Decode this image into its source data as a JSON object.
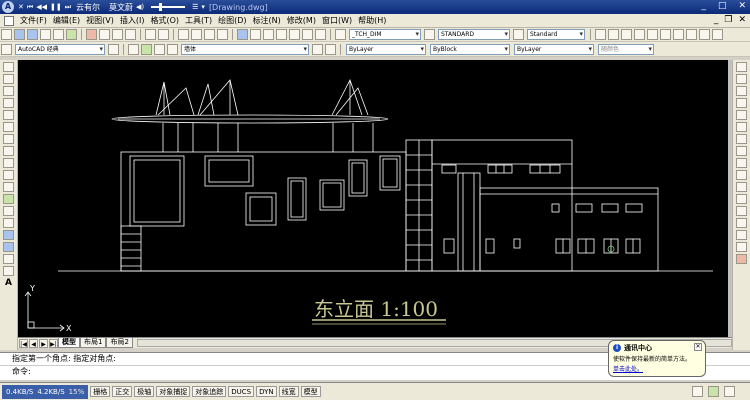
{
  "media": {
    "track": "云有尔",
    "artist": "莫文蔚",
    "doc_title": "[Drawing.dwg]"
  },
  "menu": [
    "文件(F)",
    "编辑(E)",
    "视图(V)",
    "插入(I)",
    "格式(O)",
    "工具(T)",
    "绘图(D)",
    "标注(N)",
    "修改(M)",
    "窗口(W)",
    "帮助(H)"
  ],
  "toolbar1": {
    "text_style": "_TCH_DIM",
    "dim_style": "STANDARD",
    "table_style": "Standard"
  },
  "toolbar2": {
    "workspace": "AutoCAD 经典",
    "layer": "墙体",
    "color": "ByLayer",
    "linetype": "ByBlock",
    "lineweight": "ByLayer",
    "plot_style": "随颜色"
  },
  "drawing": {
    "title": "东立面 1:100",
    "axis_y": "Y",
    "axis_x": "X"
  },
  "tabs": [
    "模型",
    "布局1",
    "布局2"
  ],
  "command": {
    "history": "指定第一个角点: 指定对角点:",
    "prompt": "命令:"
  },
  "status": {
    "net_up": "0.4KB/S",
    "net_down": "4.2KB/S",
    "cpu": "15%",
    "buttons": [
      "栅格",
      "正交",
      "极轴",
      "对象捕捉",
      "对象追踪",
      "DUCS",
      "DYN",
      "线宽",
      "模型"
    ]
  },
  "comm_center": {
    "title": "通讯中心",
    "message": "使软件保持最新的简单方法。",
    "link": "单击此处。"
  },
  "colors": {
    "canvas_bg": "#000000",
    "drawing_lines": "#ffffff",
    "title_text": "#c8c890",
    "title_bar": "#0b2a78"
  }
}
